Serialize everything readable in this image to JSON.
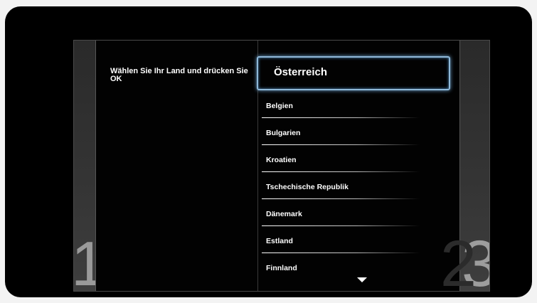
{
  "wizard": {
    "instruction": "Wählen Sie Ihr Land und drücken Sie OK",
    "steps": [
      "1",
      "2",
      "3"
    ]
  },
  "countries": {
    "items": [
      {
        "label": "Österreich",
        "selected": true
      },
      {
        "label": "Belgien",
        "selected": false
      },
      {
        "label": "Bulgarien",
        "selected": false
      },
      {
        "label": "Kroatien",
        "selected": false
      },
      {
        "label": "Tschechische Republik",
        "selected": false
      },
      {
        "label": "Dänemark",
        "selected": false
      },
      {
        "label": "Estland",
        "selected": false
      },
      {
        "label": "Finnland",
        "selected": false
      }
    ],
    "scroll_icon": "chevron-down-icon"
  },
  "colors": {
    "background": "#000000",
    "highlight": "#8fb8d8",
    "text": "#ffffff"
  }
}
